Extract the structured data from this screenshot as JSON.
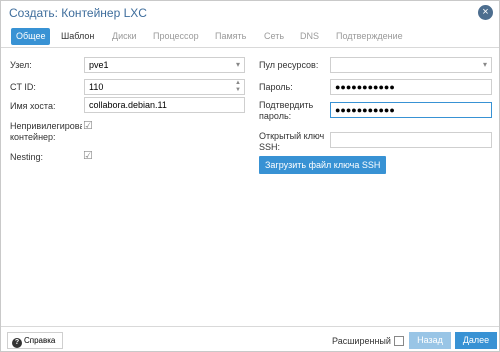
{
  "window": {
    "title": "Создать: Контейнер LXC"
  },
  "tabs": [
    {
      "label": "Общее"
    },
    {
      "label": "Шаблон"
    },
    {
      "label": "Диски"
    },
    {
      "label": "Процессор"
    },
    {
      "label": "Память"
    },
    {
      "label": "Сеть"
    },
    {
      "label": "DNS"
    },
    {
      "label": "Подтверждение"
    }
  ],
  "form": {
    "node": {
      "label": "Узел:",
      "value": "pve1"
    },
    "ctid": {
      "label": "CT ID:",
      "value": "110"
    },
    "hostname": {
      "label": "Имя хоста:",
      "value": "collabora.debian.11"
    },
    "unprivileged": {
      "label_line1": "Непривилегирова",
      "label_line2": "контейнер:",
      "checked": true
    },
    "nesting": {
      "label": "Nesting:",
      "checked": true
    },
    "pool": {
      "label": "Пул ресурсов:",
      "value": ""
    },
    "password": {
      "label": "Пароль:",
      "value": "●●●●●●●●●●●"
    },
    "confirm": {
      "label_line1": "Подтвердить",
      "label_line2": "пароль:",
      "value": "●●●●●●●●●●●"
    },
    "sshkey": {
      "label_line1": "Открытый ключ",
      "label_line2": "SSH:",
      "value": ""
    },
    "load_ssh_label": "Загрузить файл ключа SSH"
  },
  "footer": {
    "help_label": "Справка",
    "advanced_label": "Расширенный",
    "advanced_checked": false,
    "back_label": "Назад",
    "next_label": "Далее"
  },
  "colors": {
    "accent": "#3892d4",
    "title": "#3e6d9c"
  }
}
